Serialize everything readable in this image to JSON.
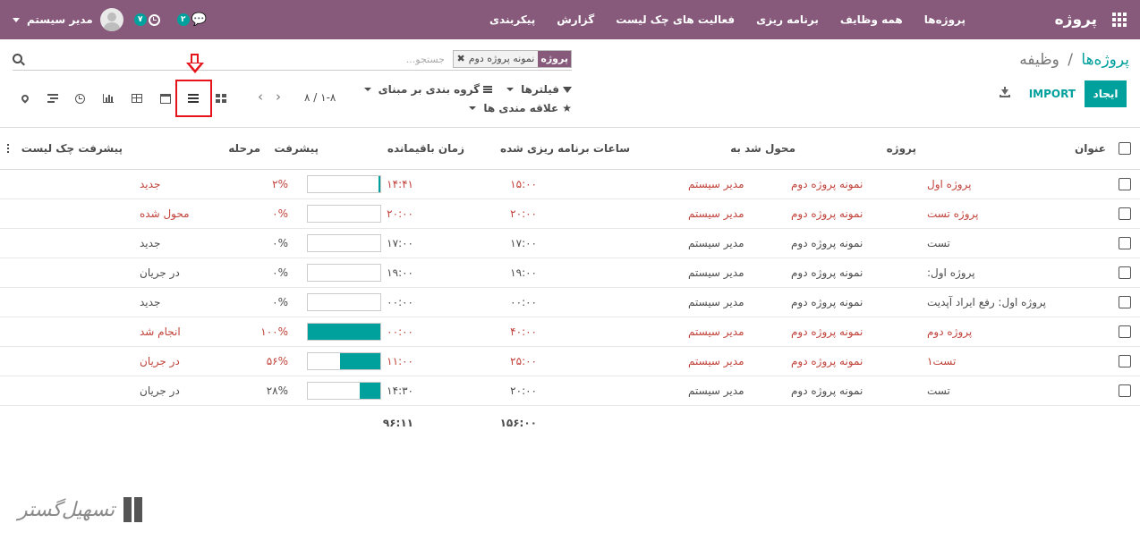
{
  "navbar": {
    "brand": "پروژه",
    "menu": [
      "پروژه‌ها",
      "همه وظایف",
      "برنامه ریزی",
      "فعالیت های چک لیست",
      "گزارش",
      "پیکربندی"
    ],
    "user_name": "مدیر سیستم",
    "activity_count": "۷",
    "message_count": "۲"
  },
  "breadcrumb": {
    "parent": "پروژه‌ها",
    "separator": "/",
    "current": "وظیفه"
  },
  "search": {
    "facet_label": "پروژه",
    "facet_value": "نمونه پروژه دوم",
    "facet_remove": "✖",
    "placeholder": "جستجو..."
  },
  "buttons": {
    "create": "ایجاد",
    "import": "IMPORT"
  },
  "filters": {
    "filters_label": "فیلترها",
    "groupby_label": "گروه بندی بر مبنای",
    "favorites_label": "علاقه مندی ها"
  },
  "pager": {
    "value": "۱-۸ / ۸"
  },
  "annotation": {
    "highlighted_view": "list"
  },
  "table": {
    "headers": {
      "title": "عنوان",
      "project": "پروژه",
      "assignee": "محول شد به",
      "planned_hours": "ساعات برنامه ریزی شده",
      "remaining_hours": "زمان باقیمانده",
      "progress": "پیشرفت",
      "stage": "مرحله",
      "checklist_progress": "پیشرفت چک لیست"
    },
    "rows": [
      {
        "title": "پروژه اول",
        "project": "نمونه پروژه دوم",
        "assignee": "مدیر سیستم",
        "planned": "۱۵:۰۰",
        "remaining": "۱۴:۴۱",
        "progress": 2,
        "progress_label": "۲%",
        "stage": "جدید",
        "overdue": true
      },
      {
        "title": "پروژه تست",
        "project": "نمونه پروژه دوم",
        "assignee": "مدیر سیستم",
        "planned": "۲۰:۰۰",
        "remaining": "۲۰:۰۰",
        "progress": 0,
        "progress_label": "۰%",
        "stage": "محول شده",
        "overdue": true
      },
      {
        "title": "تست",
        "project": "نمونه پروژه دوم",
        "assignee": "مدیر سیستم",
        "planned": "۱۷:۰۰",
        "remaining": "۱۷:۰۰",
        "progress": 0,
        "progress_label": "۰%",
        "stage": "جدید",
        "overdue": false
      },
      {
        "title": "پروژه اول:",
        "project": "نمونه پروژه دوم",
        "assignee": "مدیر سیستم",
        "planned": "۱۹:۰۰",
        "remaining": "۱۹:۰۰",
        "progress": 0,
        "progress_label": "۰%",
        "stage": "در جریان",
        "overdue": false
      },
      {
        "title": "پروژه اول: رفع ایراد آپدیت",
        "project": "نمونه پروژه دوم",
        "assignee": "مدیر سیستم",
        "planned": "۰۰:۰۰",
        "remaining": "۰۰:۰۰",
        "progress": 0,
        "progress_label": "۰%",
        "stage": "جدید",
        "overdue": false
      },
      {
        "title": "پروژه دوم",
        "project": "نمونه پروژه دوم",
        "assignee": "مدیر سیستم",
        "planned": "۴۰:۰۰",
        "remaining": "۰۰:۰۰",
        "progress": 100,
        "progress_label": "۱۰۰%",
        "stage": "انجام شد",
        "overdue": true
      },
      {
        "title": "تست۱",
        "project": "نمونه پروژه دوم",
        "assignee": "مدیر سیستم",
        "planned": "۲۵:۰۰",
        "remaining": "۱۱:۰۰",
        "progress": 56,
        "progress_label": "۵۶%",
        "stage": "در جریان",
        "overdue": true
      },
      {
        "title": "تست",
        "project": "نمونه پروژه دوم",
        "assignee": "مدیر سیستم",
        "planned": "۲۰:۰۰",
        "remaining": "۱۴:۳۰",
        "progress": 28,
        "progress_label": "۲۸%",
        "stage": "در جریان",
        "overdue": false
      }
    ],
    "totals": {
      "planned": "۱۵۶:۰۰",
      "remaining": "۹۶:۱۱"
    }
  },
  "colors": {
    "brand": "#875a7b",
    "accent": "#00a09d",
    "overdue": "#c1433b",
    "highlight": "#e5141b"
  },
  "icons": {
    "apps": "grid-icon",
    "views": [
      "kanban-icon",
      "list-icon",
      "calendar-icon",
      "pivot-icon",
      "graph-icon",
      "activity-icon",
      "gantt-icon",
      "map-icon"
    ],
    "download": "download-icon",
    "search": "search-icon"
  }
}
